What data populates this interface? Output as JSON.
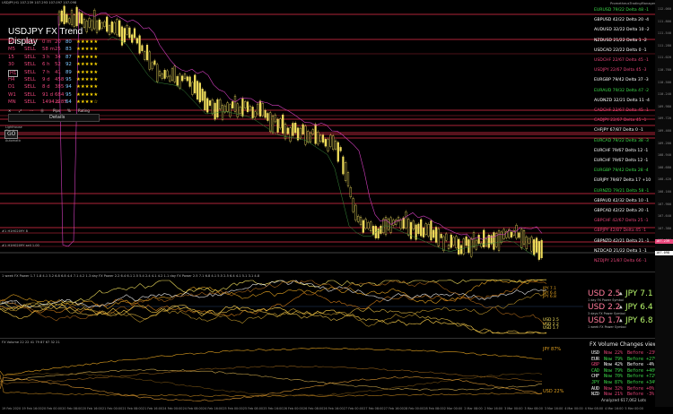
{
  "chart_title": "USDJPY,H1  107.239 107.293 107.097 107.098",
  "top_right_label": "PrometheusTradingManager",
  "fx_trend": {
    "title": "USDJPY FX Trend Display",
    "rows": [
      {
        "tf": "M1",
        "dir": "SELL",
        "time": "0 m",
        "pips": "20",
        "pct": "80",
        "stars": "★★★★★"
      },
      {
        "tf": "M5",
        "dir": "SELL",
        "time": "58 m",
        "pips": "25",
        "pct": "83",
        "stars": "★★★★★"
      },
      {
        "tf": "15",
        "dir": "SELL",
        "time": "3 h",
        "pips": "34",
        "pct": "87",
        "stars": "★★★★★"
      },
      {
        "tf": "30",
        "dir": "SELL",
        "time": "6 h",
        "pips": "52",
        "pct": "92",
        "stars": "★★★★★"
      },
      {
        "tf": "H1",
        "dir": "SELL",
        "time": "7 h",
        "pips": "41",
        "pct": "89",
        "stars": "★★★★★"
      },
      {
        "tf": "H4",
        "dir": "SELL",
        "time": "9 d",
        "pips": "458",
        "pct": "95",
        "stars": "★★★★★"
      },
      {
        "tf": "D1",
        "dir": "SELL",
        "time": "8 d",
        "pips": "385",
        "pct": "94",
        "stars": "★★★★★"
      },
      {
        "tf": "W1",
        "dir": "SELL",
        "time": "91 d",
        "pips": "684",
        "pct": "95",
        "stars": "★★★★★"
      },
      {
        "tf": "MN",
        "dir": "SELL",
        "time": "1494 d",
        "pips": "2285",
        "pct": "64",
        "stars": "★★★★☆"
      }
    ],
    "footer": [
      "✕",
      "⤢",
      "⋯",
      "⓪",
      "Pips",
      "%",
      "Rating"
    ],
    "details_label": "Details"
  },
  "lighthouse": {
    "title": "Lighthouse Check",
    "go": "GO",
    "sub": "Automatic"
  },
  "hline_labels": [
    "#1 H1H0209Y 8",
    "#1 H1H0209Y sell 1.00"
  ],
  "pair_list": [
    {
      "text": "EURUSD 79/22 Delta 48  -1",
      "color": "#3ddc4a"
    },
    {
      "text": "GBPUSD 42/22 Delta 20  -4",
      "color": "#ffffff"
    },
    {
      "text": "AUDUSD 32/22 Delta 10  -2",
      "color": "#ffffff"
    },
    {
      "text": "NZDUSD 21/22 Delta  1  -2",
      "color": "#ffffff"
    },
    {
      "text": "USDCAD 22/22 Delta  0  -1",
      "color": "#ffffff"
    },
    {
      "text": "USDCHF 22/67 Delta 45  -1",
      "color": "#e8457a"
    },
    {
      "text": "USDJPY 22/67 Delta 45  -3",
      "color": "#e8457a"
    },
    {
      "text": "EURGBP 79/42 Delta 37  -3",
      "color": "#ffffff"
    },
    {
      "text": "EURAUD 79/32 Delta 47  -2",
      "color": "#3ddc4a"
    },
    {
      "text": "AUDNZD 32/21 Delta 11  -4",
      "color": "#ffffff"
    },
    {
      "text": "CADCHF 22/67 Delta 45  -1",
      "color": "#e8457a"
    },
    {
      "text": "CADJPY 22/67 Delta 45  -1",
      "color": "#e8457a"
    },
    {
      "text": "CHFJPY 67/87 Delta  0  -1",
      "color": "#ffffff"
    },
    {
      "text": "EURCAD 79/22 Delta 38  -3",
      "color": "#3ddc4a"
    },
    {
      "text": "EURCHF 79/67 Delta 12  -1",
      "color": "#ffffff"
    },
    {
      "text": "EURCHF 79/67 Delta 12  -1",
      "color": "#ffffff"
    },
    {
      "text": "EURGBP 79/42 Delta 28  -4",
      "color": "#3ddc4a"
    },
    {
      "text": "EURJPY 79/87 Delta 17 +10",
      "color": "#ffffff"
    },
    {
      "text": "EURNZD 79/21 Delta 58  -1",
      "color": "#3ddc4a"
    },
    {
      "text": "GBPAUD 42/32 Delta 10  -1",
      "color": "#ffffff"
    },
    {
      "text": "GBPCAD 42/22 Delta 20  -1",
      "color": "#ffffff"
    },
    {
      "text": "GBPCHF 42/67 Delta 25  -1",
      "color": "#e8457a"
    },
    {
      "text": "GBPJPY 42/87 Delta 45  -1",
      "color": "#e8457a"
    },
    {
      "text": "GBPNZD 42/21 Delta 21  -1",
      "color": "#ffffff"
    },
    {
      "text": "NZDCAD 21/22 Delta  1  -1",
      "color": "#ffffff"
    },
    {
      "text": "NZDJPY 21/87 Delta 66  -1",
      "color": "#e8457a"
    }
  ],
  "osc": {
    "title": "1 week  FX Power  1.7  1.8  4.1  3.2  6.8  6.8  4.4  7.1  4.2  1.3 day  FX Power  2.2  6.4  6.1  2.5  5.4  2.4  4.1  4.2  1.1 day  FX Power  2.5  7.1  6.8  4.1  5.5  2.5  6.4  4.1  5.1  3.1  4.8",
    "left_label": "Blok  -1.3",
    "blocks": [
      {
        "usd": "USD 2.5",
        "jpy": "JPY 7.1",
        "period": "1 day"
      },
      {
        "usd": "USD 2.2",
        "jpy": "JPY 6.4",
        "period": "3 days"
      },
      {
        "usd": "USD 1.7",
        "jpy": "JPY 6.8",
        "period": "1 week"
      }
    ],
    "block_sub": [
      "FX Power",
      "Symbol"
    ],
    "right_levels_top": [
      "JPY 7.1",
      "JPY 6.4",
      "JPY 6.8"
    ],
    "right_levels_bot": [
      "USD 2.5",
      "USD 2.2",
      "USD 1.7"
    ],
    "usd_color": "#ff7a9a",
    "jpy_color": "#b7f56b"
  },
  "volume": {
    "title": "FX Volume  22  22  41  79  87  67  32  21",
    "heading": "FX Volume Changes view",
    "rows": [
      {
        "cur": "USD",
        "now": "Now 22%",
        "before": "Before -23%",
        "color": "#ffffff",
        "vcolor": "#e8457a"
      },
      {
        "cur": "EUR",
        "now": "Now 79%",
        "before": "Before +27%",
        "color": "#ffffff",
        "vcolor": "#3ddc4a"
      },
      {
        "cur": "GBP",
        "now": "Now 42%",
        "before": "Before -4%",
        "color": "#e8457a",
        "vcolor": "#ffffff"
      },
      {
        "cur": "CAD",
        "now": "Now 79%",
        "before": "Before +40%",
        "color": "#3ddc4a",
        "vcolor": "#3ddc4a"
      },
      {
        "cur": "CHF",
        "now": "Now 70%",
        "before": "Before +72%",
        "color": "#ffffff",
        "vcolor": "#3ddc4a"
      },
      {
        "cur": "JPY",
        "now": "Now 87%",
        "before": "Before +34%",
        "color": "#3ddc4a",
        "vcolor": "#3ddc4a"
      },
      {
        "cur": "AUD",
        "now": "Now 32%",
        "before": "Before +0%",
        "color": "#ffffff",
        "vcolor": "#e8457a"
      },
      {
        "cur": "NZD",
        "now": "Now 21%",
        "before": "Before -3%",
        "color": "#ffffff",
        "vcolor": "#e8457a"
      }
    ],
    "footer": "Analyzed 617,062 Lots",
    "jpy_label": "JPY 87%",
    "usd_label": "USD 22%"
  },
  "x_axis": [
    "19 Feb 2020",
    "19 Feb 16:00",
    "20 Feb 00:00",
    "20 Feb 08:00",
    "20 Feb 16:00",
    "21 Feb 00:00",
    "21 Feb 08:00",
    "21 Feb 16:00",
    "24 Feb 00:00",
    "24 Feb 08:00",
    "24 Feb 16:00",
    "25 Feb 00:00",
    "25 Feb 08:00",
    "25 Feb 16:00",
    "26 Feb 00:00",
    "26 Feb 08:00",
    "26 Feb 16:00",
    "27 Feb 00:00",
    "27 Feb 08:00",
    "27 Feb 16:00",
    "28 Feb 00:00",
    "28 Feb 08:00",
    "2 Mar 00:00",
    "2 Mar 08:00",
    "2 Mar 16:00",
    "3 Mar 00:00",
    "3 Mar 08:00",
    "3 Mar 16:00",
    "4 Mar 00:00",
    "4 Mar 08:00",
    "4 Mar 16:00",
    "5 Mar 00:00"
  ],
  "y_axis": [
    "112.060",
    "111.800",
    "111.540",
    "111.280",
    "111.020",
    "110.760",
    "110.500",
    "110.240",
    "109.980",
    "109.720",
    "109.460",
    "109.200",
    "108.940",
    "108.680",
    "108.420",
    "108.160",
    "107.900",
    "107.640",
    "107.380",
    "107.120",
    "106.860"
  ],
  "price_labels": [
    {
      "text": "107.239",
      "color": "#ffb3c6"
    },
    {
      "text": "107.098",
      "color": "#ffffff"
    }
  ]
}
